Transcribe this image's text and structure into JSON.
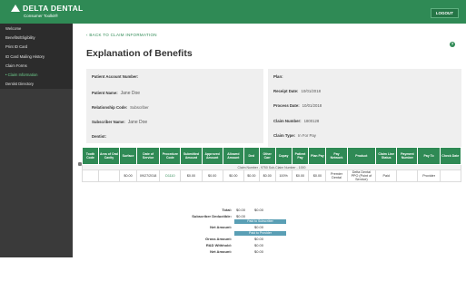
{
  "header": {
    "brand": "DELTA DENTAL",
    "tagline": "Consumer Toolkit®",
    "logout_label": "LOGOUT"
  },
  "sidebar": {
    "items": [
      {
        "label": "Consumer Toolkit",
        "type": "main"
      },
      {
        "label": "Welcome",
        "type": "sub"
      },
      {
        "label": "Benefits/Eligibility",
        "type": "sub"
      },
      {
        "label": "Print ID Card",
        "type": "sub"
      },
      {
        "label": "ID Card Mailing History",
        "type": "sub"
      },
      {
        "label": "Claim Forms",
        "type": "sub"
      },
      {
        "label": "• Claim Information",
        "type": "active"
      },
      {
        "label": "Dentist Directory",
        "type": "sub"
      },
      {
        "label": "Health & Wellness",
        "type": "main"
      },
      {
        "label": "Help",
        "type": "main"
      },
      {
        "label": "Profile",
        "type": "main"
      },
      {
        "label": "Contact Us",
        "type": "main"
      },
      {
        "label": "Cost Estimator",
        "type": "main"
      },
      {
        "label": "Logout",
        "type": "main"
      }
    ]
  },
  "main": {
    "back_link": "‹ BACK TO CLAIM INFORMATION",
    "title": "Explanation of Benefits",
    "help_glyph": "?"
  },
  "left_panel": {
    "patient_account_label": "Patient Account Number:",
    "patient_name_label": "Patient Name:",
    "patient_name_value": "Jane Doe",
    "relationship_label": "Relationship Code:",
    "relationship_value": "Subscriber",
    "subscriber_name_label": "Subscriber Name:",
    "subscriber_name_value": "Jane Doe",
    "dentist_label": "Dentist:"
  },
  "right_panel": {
    "plan_label": "Plan:",
    "receipt_date_label": "Receipt Date:",
    "receipt_date_value": "10/01/2018",
    "process_date_label": "Process Date:",
    "process_date_value": "10/01/2018",
    "claim_number_label": "Claim Number:",
    "claim_number_value": "1800128",
    "claim_type_label": "Claim Type:",
    "claim_type_value": "In For Pay",
    "claim_status_label": "Claim Status:",
    "claim_status_value": "Paid",
    "other_carrier_label": "Other Carrier Payment:"
  },
  "claim_table": {
    "columns": [
      "Tooth Code",
      "Area of Oral Cavity",
      "Surface",
      "Date of Service",
      "Procedure Code",
      "Submitted Amount",
      "Approved Amount",
      "Allowed Amount",
      "Ded",
      "Other Carr",
      "Copay",
      "Patient Pay",
      "Plan Pay",
      "Pay Network",
      "Product",
      "Claim Line Status",
      "Payment Number",
      "Pay To",
      "Check Date"
    ],
    "claim_number_row": "Claim Number - 9750 Sub-Claim Number - 1000",
    "row": [
      "",
      "",
      "",
      "09/27/2018",
      "D1110",
      "$0.00",
      "$0.00",
      "$0.00",
      "$0.00",
      "$0.00",
      "100%",
      "$0.00",
      "$0.00",
      "Premier Dental",
      "Delta Dental PPO (Point of Service)",
      "Paid",
      "",
      "Provider",
      ""
    ],
    "row_first_amount": "$0.00"
  },
  "totals": {
    "total_label": "Total:",
    "total_values": [
      "$0.00",
      "$0.00"
    ],
    "deductible_label": "Subscriber Deductible:",
    "deductible_value": "$0.00",
    "paid_to_subscriber": "Paid to Subscriber",
    "net_amount_label_1": "Net Amount:",
    "net_amount_value_1": "$0.00",
    "paid_to_provider": "Paid to Provider",
    "gross_amount_label": "Gross Amount:",
    "gross_amount_value": "$0.00",
    "withhold_label": "R&D Withhold:",
    "withhold_value": "$0.00",
    "net_amount_label_2": "Net Amount:",
    "net_amount_value_2": "$0.00"
  },
  "colors": {
    "brand_green": "#2f8a55",
    "sidebar_bg": "#3a3a3a",
    "bar_blue": "#5a9fb5"
  }
}
